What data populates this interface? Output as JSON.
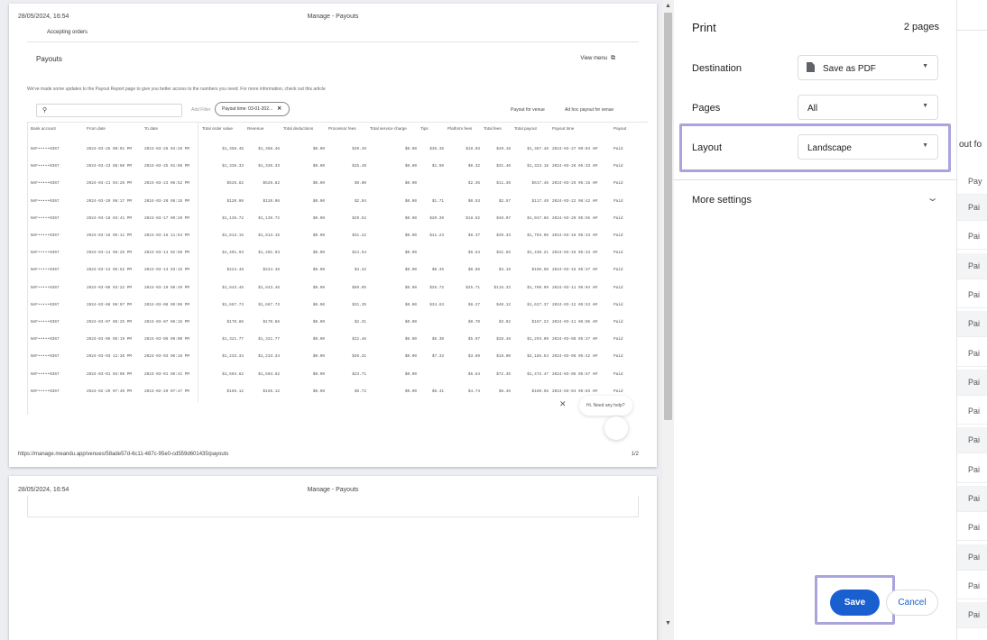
{
  "preview": {
    "page1": {
      "header_date": "28/05/2024, 16:54",
      "header_title": "Manage - Payouts",
      "accepting_orders": "Accepting orders",
      "app_title": "Payouts",
      "view_menu": "View menu",
      "notice": "We've made some updates to the Payout Report page to give you better access to the numbers you need. For more information, check out this article",
      "add_filter": "Add Filter",
      "filter_chip": "Payout time: 03-01-202...",
      "link_payout_for_venue": "Payout for venue",
      "link_ad_hoc_payout": "Ad hoc payout for venue",
      "columns": [
        "Bank account",
        "From date",
        "To date",
        "Total order value",
        "Revenue",
        "Total deductions",
        "Processor fees",
        "Total service charge",
        "Tips",
        "Platform fees",
        "Total fees",
        "Total payout",
        "Payout time",
        "Payout"
      ],
      "rows": [
        [
          "NAF•••••0367",
          "2024-03-25 09:01 PM",
          "2024-03-26 04:28 PM",
          "$1,356.46",
          "$1,356.46",
          "$0.00",
          "$39.49",
          "$0.00",
          "$38.36",
          "$18.03",
          "$49.18",
          "$1,367.48",
          "2024-03-27 09:04 AM",
          "Paid"
        ],
        [
          "NAF•••••0367",
          "2024-03-23 08:08 PM",
          "2024-03-25 01:06 PM",
          "$1,336.33",
          "$1,336.33",
          "$0.00",
          "$25.49",
          "$0.00",
          "$1.50",
          "$0.32",
          "$31.40",
          "$1,323.18",
          "2024-03-26 05:33 AM",
          "Paid"
        ],
        [
          "NAF•••••0367",
          "2024-03-21 04:26 PM",
          "2024-03-23 06:52 PM",
          "$526.82",
          "$526.82",
          "$0.00",
          "$9.00",
          "$0.00",
          "",
          "$2.36",
          "$11.36",
          "$517.46",
          "2024-03-25 05:15 AM",
          "Paid"
        ],
        [
          "NAF•••••0367",
          "2024-03-20 06:17 PM",
          "2024-03-20 06:15 PM",
          "$120.06",
          "$120.06",
          "$0.00",
          "$2.04",
          "$0.00",
          "$1.71",
          "$0.53",
          "$2.57",
          "$117.49",
          "2024-03-22 06:42 AM",
          "Paid"
        ],
        [
          "NAF•••••0367",
          "2024-03-18 03:41 PM",
          "2024-03-17 09:29 PM",
          "$1,136.72",
          "$1,136.72",
          "$0.00",
          "$29.52",
          "$0.00",
          "$20.39",
          "$18.62",
          "$48.07",
          "$1,047.88",
          "2024-03-20 05:55 AM",
          "Paid"
        ],
        [
          "NAF•••••0367",
          "2024-03-16 05:11 PM",
          "2024-03-16 11:54 PM",
          "$1,813.15",
          "$1,813.15",
          "$0.00",
          "$31.22",
          "$0.00",
          "$11.23",
          "$8.37",
          "$39.33",
          "$1,793.96",
          "2024-03-18 05:33 AM",
          "Paid"
        ],
        [
          "NAF•••••0367",
          "2024-03-14 06:25 PM",
          "2024-03-14 02:50 PM",
          "$1,401.93",
          "$1,401.93",
          "$0.00",
          "$24.54",
          "$0.00",
          "",
          "$6.54",
          "$31.65",
          "$1,430.21",
          "2024-03-16 05:33 AM",
          "Paid"
        ],
        [
          "NAF•••••0367",
          "2024-03-13 05:52 PM",
          "2024-03-13 03:15 PM",
          "$224.48",
          "$224.48",
          "$0.00",
          "$4.32",
          "$0.00",
          "$0.35",
          "$0.86",
          "$4.18",
          "$195.50",
          "2024-03-15 05:37 AM",
          "Paid"
        ],
        [
          "NAF•••••0367",
          "2024-03-08 03:22 PM",
          "2024-03-10 08:49 PM",
          "$1,843.46",
          "$1,843.46",
          "$0.00",
          "$69.95",
          "$0.00",
          "$25.72",
          "$25.71",
          "$115.33",
          "$1,780.99",
          "2024-03-11 06:04 AM",
          "Paid"
        ],
        [
          "NAF•••••0367",
          "2024-03-08 08:07 PM",
          "2024-03-08 09:06 PM",
          "$1,667.73",
          "$1,667.73",
          "$0.00",
          "$31.35",
          "$0.00",
          "$34.63",
          "$8.27",
          "$40.12",
          "$1,627.37",
          "2024-03-12 05:53 AM",
          "Paid"
        ],
        [
          "NAF•••••0367",
          "2024-03-07 05:25 PM",
          "2024-03-07 06:15 PM",
          "$170.86",
          "$170.86",
          "$0.00",
          "$2.31",
          "$0.00",
          "",
          "$0.70",
          "$3.02",
          "$167.23",
          "2024-03-11 06:05 AM",
          "Paid"
        ],
        [
          "NAF•••••0367",
          "2024-03-06 05:19 PM",
          "2024-03-06 09:00 PM",
          "$1,321.77",
          "$1,321.77",
          "$0.00",
          "$22.46",
          "$0.00",
          "$6.30",
          "$5.97",
          "$28.48",
          "$1,293.09",
          "2024-03-08 05:37 AM",
          "Paid"
        ],
        [
          "NAF•••••0367",
          "2024-03-03 12:36 PM",
          "2024-03-03 06:16 PM",
          "$1,233.34",
          "$1,233.34",
          "$0.00",
          "$36.31",
          "$0.00",
          "$7.33",
          "$3.89",
          "$18.00",
          "$2,185.54",
          "2024-03-06 05:42 AM",
          "Paid"
        ],
        [
          "NAF•••••0367",
          "2024-03-01 04:06 PM",
          "2024-03-01 06:41 PM",
          "$1,504.62",
          "$1,504.62",
          "$0.00",
          "$23.71",
          "$0.00",
          "",
          "$6.54",
          "$72.35",
          "$1,472.47",
          "2024-03-05 05:57 AM",
          "Paid"
        ],
        [
          "NAF•••••0367",
          "2024-02-29 07:40 PM",
          "2024-02-29 07:47 PM",
          "$165.12",
          "$165.12",
          "$0.00",
          "$5.72",
          "$0.00",
          "$0.41",
          "$4.74",
          "$6.46",
          "$160.56",
          "2024-03-04 05:03 AM",
          "Paid"
        ]
      ],
      "help_text": "Hi. Need any help?",
      "footer_url": "https://manage.meandu.app/venues/58ade57d-6c11-487c-95e0-cd559d601435/payouts",
      "footer_page": "1/2"
    },
    "page2": {
      "header_date": "28/05/2024, 16:54",
      "header_title": "Manage - Payouts"
    }
  },
  "print": {
    "title": "Print",
    "page_count": "2 pages",
    "destination_label": "Destination",
    "destination_value": "Save as PDF",
    "pages_label": "Pages",
    "pages_value": "All",
    "layout_label": "Layout",
    "layout_value": "Landscape",
    "more_settings": "More settings",
    "save": "Save",
    "cancel": "Cancel",
    "accent_color": "#1a5fd0",
    "highlight_color": "#a9a4dd"
  },
  "background": {
    "header_fragment": "out fo",
    "column_fragment": "Pay",
    "cell_fragment": "Pai"
  }
}
